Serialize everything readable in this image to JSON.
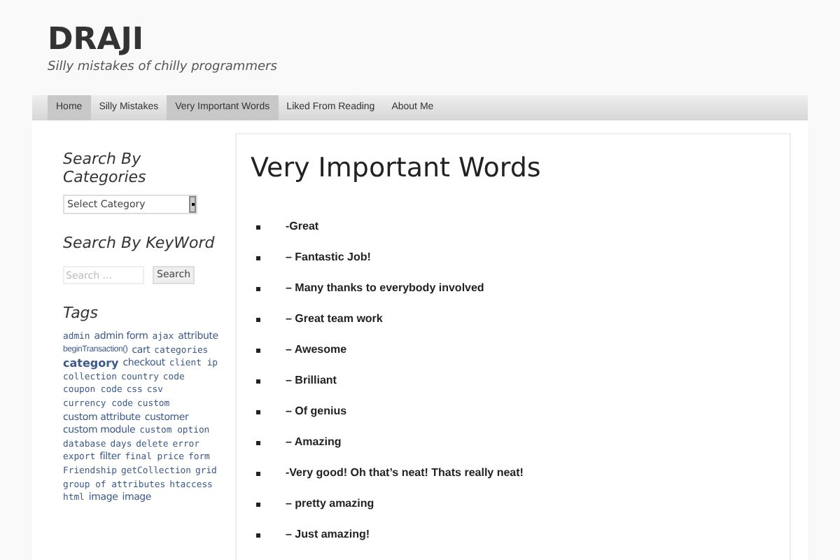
{
  "site": {
    "title": "DRAJI",
    "tagline": "Silly mistakes of chilly programmers"
  },
  "nav": [
    {
      "label": "Home",
      "selected": true
    },
    {
      "label": "Silly Mistakes",
      "selected": false
    },
    {
      "label": "Very Important Words",
      "selected": true
    },
    {
      "label": "Liked From Reading",
      "selected": false
    },
    {
      "label": "About Me",
      "selected": false
    }
  ],
  "sidebar": {
    "category_widget": {
      "title": "Search By Categories",
      "select": "Select Category"
    },
    "search_widget": {
      "title": "Search By KeyWord",
      "placeholder": "Search ...",
      "button": "Search"
    },
    "tags_widget": {
      "title": "Tags",
      "tags": [
        {
          "label": "admin",
          "kind": "small"
        },
        {
          "label": "admin form",
          "kind": "medium"
        },
        {
          "label": "ajax",
          "kind": "small"
        },
        {
          "label": "attribute",
          "kind": "medium"
        },
        {
          "label": "beginTransaction()",
          "kind": "tiny"
        },
        {
          "label": "cart",
          "kind": "medium"
        },
        {
          "label": "categories",
          "kind": "small"
        },
        {
          "label": "category",
          "kind": "large"
        },
        {
          "label": "checkout",
          "kind": "medium"
        },
        {
          "label": "client ip",
          "kind": "small"
        },
        {
          "label": "collection",
          "kind": "small"
        },
        {
          "label": "country",
          "kind": "small"
        },
        {
          "label": "code",
          "kind": "small"
        },
        {
          "label": "coupon code",
          "kind": "small"
        },
        {
          "label": "css",
          "kind": "small"
        },
        {
          "label": "csv",
          "kind": "small"
        },
        {
          "label": "currency code",
          "kind": "small"
        },
        {
          "label": "custom",
          "kind": "small"
        },
        {
          "label": "custom attribute",
          "kind": "medium"
        },
        {
          "label": "customer",
          "kind": "medium"
        },
        {
          "label": "custom module",
          "kind": "medium"
        },
        {
          "label": "custom option",
          "kind": "small"
        },
        {
          "label": "database",
          "kind": "small"
        },
        {
          "label": "days",
          "kind": "small"
        },
        {
          "label": "delete",
          "kind": "small"
        },
        {
          "label": "error",
          "kind": "small"
        },
        {
          "label": "export",
          "kind": "small"
        },
        {
          "label": "filter",
          "kind": "medium"
        },
        {
          "label": "final price",
          "kind": "small"
        },
        {
          "label": "form",
          "kind": "small"
        },
        {
          "label": "Friendship",
          "kind": "small"
        },
        {
          "label": "getCollection",
          "kind": "small"
        },
        {
          "label": "grid",
          "kind": "small"
        },
        {
          "label": "group of attributes",
          "kind": "small"
        },
        {
          "label": "htaccess",
          "kind": "small"
        },
        {
          "label": "html",
          "kind": "small"
        },
        {
          "label": "image",
          "kind": "medium"
        },
        {
          "label": "image",
          "kind": "medium"
        }
      ]
    }
  },
  "page": {
    "title": "Very Important Words",
    "items": [
      "-Great",
      "– Fantastic Job!",
      "– Many thanks to everybody involved",
      "– Great team work",
      "– Awesome",
      "– Brilliant",
      "– Of genius",
      "– Amazing",
      "-Very good! Oh that’s neat! Thats really neat!",
      "– pretty amazing",
      "– Just amazing!"
    ]
  }
}
